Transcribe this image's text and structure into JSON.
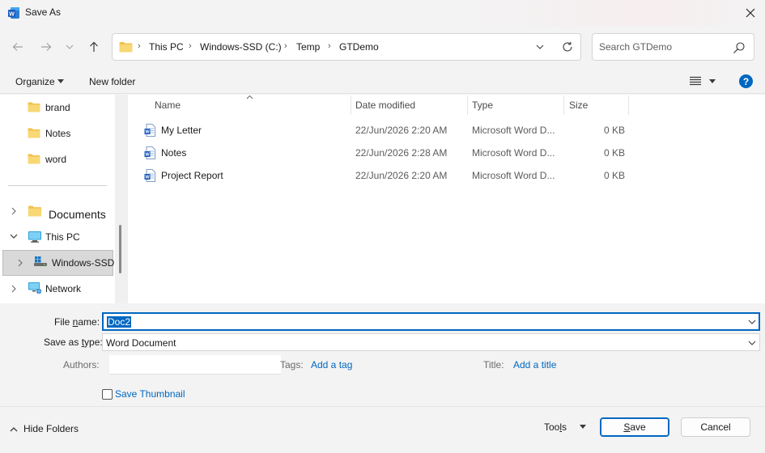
{
  "window": {
    "title": "Save As"
  },
  "address": {
    "crumbs": [
      "This PC",
      "Windows-SSD (C:)",
      "Temp",
      "GTDemo"
    ]
  },
  "search": {
    "placeholder": "Search GTDemo"
  },
  "toolbar": {
    "organize": "Organize",
    "new_folder": "New folder",
    "help": "?"
  },
  "nav": {
    "items": [
      {
        "label": "brand"
      },
      {
        "label": "Notes"
      },
      {
        "label": "word"
      },
      {
        "label": "Documents"
      },
      {
        "label": "This PC"
      },
      {
        "label": "Windows-SSD"
      },
      {
        "label": "Network"
      }
    ]
  },
  "columns": {
    "name": "Name",
    "date": "Date modified",
    "type": "Type",
    "size": "Size"
  },
  "files": [
    {
      "name": "My Letter",
      "date": "22/Jun/2026 2:20 AM",
      "type": "Microsoft Word D...",
      "size": "0 KB"
    },
    {
      "name": "Notes",
      "date": "22/Jun/2026 2:28 AM",
      "type": "Microsoft Word D...",
      "size": "0 KB"
    },
    {
      "name": "Project Report",
      "date": "22/Jun/2026 2:20 AM",
      "type": "Microsoft Word D...",
      "size": "0 KB"
    }
  ],
  "form": {
    "file_name_label_pre": "File ",
    "file_name_label_u": "n",
    "file_name_label_post": "ame:",
    "file_name_value": "Doc2",
    "save_type_label_pre": "Save as ",
    "save_type_label_u": "t",
    "save_type_label_post": "ype:",
    "save_type_value": "Word Document",
    "authors_label": "Authors:",
    "tags_label": "Tags:",
    "tags_link": "Add a tag",
    "title_label": "Title:",
    "title_link": "Add a title",
    "thumbnail_label": "Save Thumbnail"
  },
  "footer": {
    "hide_folders": "Hide Folders",
    "tools_pre": "Too",
    "tools_u": "l",
    "tools_post": "s",
    "save_u": "S",
    "save_post": "ave",
    "cancel": "Cancel"
  },
  "colors": {
    "accent": "#0067c0",
    "folder": "#f2c14e"
  }
}
